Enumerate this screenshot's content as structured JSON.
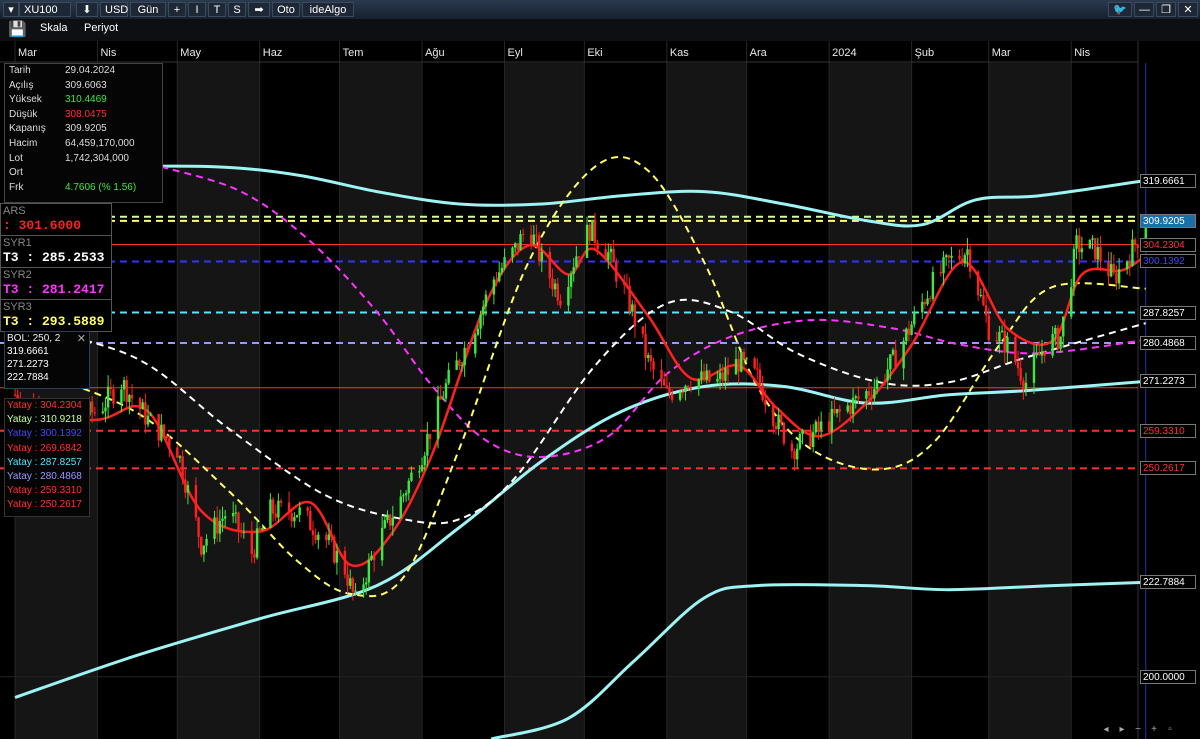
{
  "toolbar": {
    "symbol": "XU100",
    "download": "⬇",
    "currency": "USD",
    "period": "Gün",
    "add": "+",
    "b1": "I",
    "b2": "T",
    "b3": "S",
    "arrow": "➡",
    "auto": "Oto",
    "brand": "ideAlgo"
  },
  "menu": {
    "scale": "Skala",
    "period": "Periyot"
  },
  "info": {
    "rows": [
      {
        "label": "Tarih",
        "value": "29.04.2024",
        "color": "#dddddd"
      },
      {
        "label": "Açılış",
        "value": "309.6063",
        "color": "#dddddd"
      },
      {
        "label": "Yüksek",
        "value": "310.4469",
        "color": "#3ee83e"
      },
      {
        "label": "Düşük",
        "value": "308.0475",
        "color": "#ff3030"
      },
      {
        "label": "Kapanış",
        "value": "309.9205",
        "color": "#dddddd"
      },
      {
        "label": "Hacim",
        "value": "64,459,170,000",
        "color": "#dddddd"
      },
      {
        "label": "Lot",
        "value": "1,742,304,000",
        "color": "#dddddd"
      },
      {
        "label": "Ort",
        "value": "",
        "color": "#dddddd"
      },
      {
        "label": "Frk",
        "value": "4.7606 (% 1.56)",
        "color": "#3ee83e"
      }
    ]
  },
  "ars": {
    "title": "ARS",
    "value": ": 301.6000",
    "color": "#ff2020"
  },
  "syr": [
    {
      "title": "SYR1",
      "value": "T3 : 285.2533",
      "color": "#ffffff"
    },
    {
      "title": "SYR2",
      "value": "T3 : 281.2417",
      "color": "#ff33ff"
    },
    {
      "title": "SYR3",
      "value": "T3 : 293.5889",
      "color": "#ffff66"
    }
  ],
  "bol": {
    "title": "BOL: 250, 2",
    "close": "✕",
    "values": [
      "319.6661",
      "271.2273",
      "222.7884"
    ]
  },
  "yatay": [
    {
      "text": "Yatay : 304.2304",
      "color": "#ff3030"
    },
    {
      "text": "Yatay : 310.9218",
      "color": "#ccff99"
    },
    {
      "text": "Yatay : 300.1392",
      "color": "#4444ff"
    },
    {
      "text": "Yatay : 269.6842",
      "color": "#ff3030"
    },
    {
      "text": "Yatay : 287.8257",
      "color": "#55e5ff"
    },
    {
      "text": "Yatay : 280.4868",
      "color": "#9999ff"
    },
    {
      "text": "Yatay : 259.3310",
      "color": "#ff3030"
    },
    {
      "text": "Yatay : 250.2617",
      "color": "#ff3030"
    }
  ],
  "price_labels": [
    {
      "text": "319.6661",
      "value": 319.6661,
      "color": "#ffffff"
    },
    {
      "text": "309.9205",
      "value": 309.9205,
      "color": "#ffffff",
      "bg": "#1a6fa8"
    },
    {
      "text": "304.2304",
      "value": 304.2304,
      "color": "#ff3030"
    },
    {
      "text": "300.1392",
      "value": 300.1392,
      "color": "#4444ff"
    },
    {
      "text": "287.8257",
      "value": 287.8257,
      "color": "#ffffff"
    },
    {
      "text": "280.4868",
      "value": 280.4868,
      "color": "#ffffff"
    },
    {
      "text": "271.2273",
      "value": 271.2273,
      "color": "#ffffff"
    },
    {
      "text": "259.3310",
      "value": 259.331,
      "color": "#ff3030"
    },
    {
      "text": "250.2617",
      "value": 250.2617,
      "color": "#ff3030"
    },
    {
      "text": "222.7884",
      "value": 222.7884,
      "color": "#ffffff"
    },
    {
      "text": "200.0000",
      "value": 200.0,
      "color": "#ffffff"
    }
  ],
  "chart_data": {
    "type": "candlestick",
    "instrument": "XU100",
    "currency": "USD",
    "interval": "Gün",
    "ylim": [
      185.0,
      348.0
    ],
    "x_range": [
      "2023-03-01",
      "2024-05-10"
    ],
    "month_labels": [
      {
        "label": "Mar",
        "date": "2023-03-01"
      },
      {
        "label": "Nis",
        "date": "2023-04-01"
      },
      {
        "label": "May",
        "date": "2023-05-01"
      },
      {
        "label": "Haz",
        "date": "2023-06-01"
      },
      {
        "label": "Tem",
        "date": "2023-07-01"
      },
      {
        "label": "Ağu",
        "date": "2023-08-01"
      },
      {
        "label": "Eyl",
        "date": "2023-09-01"
      },
      {
        "label": "Eki",
        "date": "2023-10-01"
      },
      {
        "label": "Kas",
        "date": "2023-11-01"
      },
      {
        "label": "Ara",
        "date": "2023-12-01"
      },
      {
        "label": "2024",
        "date": "2024-01-01"
      },
      {
        "label": "Şub",
        "date": "2024-02-01"
      },
      {
        "label": "Mar",
        "date": "2024-03-01"
      },
      {
        "label": "Nis",
        "date": "2024-04-01"
      }
    ],
    "last_candle": {
      "date": "2024-04-29",
      "open": 309.6063,
      "high": 310.4469,
      "low": 308.0475,
      "close": 309.9205
    },
    "closes": [
      {
        "date": "2023-03-01",
        "value": 268
      },
      {
        "date": "2023-03-15",
        "value": 262
      },
      {
        "date": "2023-04-01",
        "value": 264
      },
      {
        "date": "2023-04-10",
        "value": 271
      },
      {
        "date": "2023-04-20",
        "value": 262
      },
      {
        "date": "2023-05-01",
        "value": 255
      },
      {
        "date": "2023-05-10",
        "value": 232
      },
      {
        "date": "2023-05-20",
        "value": 240
      },
      {
        "date": "2023-05-29",
        "value": 230
      },
      {
        "date": "2023-06-05",
        "value": 240
      },
      {
        "date": "2023-06-15",
        "value": 240
      },
      {
        "date": "2023-06-25",
        "value": 234
      },
      {
        "date": "2023-07-03",
        "value": 226
      },
      {
        "date": "2023-07-07",
        "value": 218
      },
      {
        "date": "2023-07-15",
        "value": 232
      },
      {
        "date": "2023-07-25",
        "value": 244
      },
      {
        "date": "2023-08-01",
        "value": 254
      },
      {
        "date": "2023-08-10",
        "value": 270
      },
      {
        "date": "2023-08-20",
        "value": 283
      },
      {
        "date": "2023-08-28",
        "value": 296
      },
      {
        "date": "2023-09-05",
        "value": 303
      },
      {
        "date": "2023-09-10",
        "value": 309
      },
      {
        "date": "2023-09-15",
        "value": 300
      },
      {
        "date": "2023-09-22",
        "value": 292
      },
      {
        "date": "2023-09-28",
        "value": 302
      },
      {
        "date": "2023-10-03",
        "value": 308
      },
      {
        "date": "2023-10-10",
        "value": 302
      },
      {
        "date": "2023-10-18",
        "value": 290
      },
      {
        "date": "2023-10-25",
        "value": 276
      },
      {
        "date": "2023-11-01",
        "value": 268
      },
      {
        "date": "2023-11-10",
        "value": 272
      },
      {
        "date": "2023-11-20",
        "value": 271
      },
      {
        "date": "2023-11-28",
        "value": 276
      },
      {
        "date": "2023-12-05",
        "value": 272
      },
      {
        "date": "2023-12-12",
        "value": 262
      },
      {
        "date": "2023-12-18",
        "value": 255
      },
      {
        "date": "2023-12-25",
        "value": 258
      },
      {
        "date": "2024-01-02",
        "value": 262
      },
      {
        "date": "2024-01-10",
        "value": 266
      },
      {
        "date": "2024-01-18",
        "value": 270
      },
      {
        "date": "2024-01-25",
        "value": 276
      },
      {
        "date": "2024-02-01",
        "value": 285
      },
      {
        "date": "2024-02-08",
        "value": 294
      },
      {
        "date": "2024-02-15",
        "value": 300
      },
      {
        "date": "2024-02-22",
        "value": 303
      },
      {
        "date": "2024-03-01",
        "value": 284
      },
      {
        "date": "2024-03-08",
        "value": 280
      },
      {
        "date": "2024-03-15",
        "value": 271
      },
      {
        "date": "2024-03-22",
        "value": 280
      },
      {
        "date": "2024-03-28",
        "value": 282
      },
      {
        "date": "2024-04-03",
        "value": 304
      },
      {
        "date": "2024-04-10",
        "value": 303
      },
      {
        "date": "2024-04-17",
        "value": 296
      },
      {
        "date": "2024-04-24",
        "value": 303
      },
      {
        "date": "2024-04-29",
        "value": 309.9205
      }
    ],
    "horizontal_lines": [
      {
        "value": 310.9218,
        "color": "#ccff99",
        "style": "dashed"
      },
      {
        "value": 309.9205,
        "color": "#ffff66",
        "style": "dashed"
      },
      {
        "value": 304.2304,
        "color": "#ff3030",
        "style": "solid"
      },
      {
        "value": 300.1392,
        "color": "#3333ff",
        "style": "dashed"
      },
      {
        "value": 287.8257,
        "color": "#55e5ff",
        "style": "dashed"
      },
      {
        "value": 280.4868,
        "color": "#9999ff",
        "style": "dashed"
      },
      {
        "value": 269.6842,
        "color": "#ff3030",
        "style": "solid"
      },
      {
        "value": 259.331,
        "color": "#ff3030",
        "style": "dashed"
      },
      {
        "value": 250.2617,
        "color": "#ff3030",
        "style": "dashed"
      }
    ],
    "overlays": [
      {
        "name": "BOL upper",
        "color": "#9ef3f3",
        "style": "solid",
        "points": [
          {
            "date": "2023-04-01",
            "value": 323
          },
          {
            "date": "2023-05-15",
            "value": 323
          },
          {
            "date": "2023-06-15",
            "value": 321
          },
          {
            "date": "2023-07-15",
            "value": 317
          },
          {
            "date": "2023-08-15",
            "value": 314
          },
          {
            "date": "2023-09-15",
            "value": 314
          },
          {
            "date": "2023-10-15",
            "value": 316
          },
          {
            "date": "2023-11-15",
            "value": 317
          },
          {
            "date": "2023-12-15",
            "value": 314
          },
          {
            "date": "2024-01-15",
            "value": 310
          },
          {
            "date": "2024-02-05",
            "value": 309
          },
          {
            "date": "2024-02-25",
            "value": 315
          },
          {
            "date": "2024-03-20",
            "value": 316
          },
          {
            "date": "2024-04-29",
            "value": 319.6661
          }
        ]
      },
      {
        "name": "BOL middle",
        "color": "#9ef3f3",
        "style": "solid",
        "points": [
          {
            "date": "2023-03-01",
            "value": 195
          },
          {
            "date": "2023-04-15",
            "value": 205
          },
          {
            "date": "2023-06-01",
            "value": 214
          },
          {
            "date": "2023-07-15",
            "value": 222
          },
          {
            "date": "2023-08-15",
            "value": 236
          },
          {
            "date": "2023-09-15",
            "value": 252
          },
          {
            "date": "2023-10-15",
            "value": 264
          },
          {
            "date": "2023-11-15",
            "value": 270
          },
          {
            "date": "2023-12-15",
            "value": 270
          },
          {
            "date": "2024-01-15",
            "value": 266
          },
          {
            "date": "2024-02-15",
            "value": 268
          },
          {
            "date": "2024-03-15",
            "value": 269
          },
          {
            "date": "2024-04-29",
            "value": 271.2273
          }
        ]
      },
      {
        "name": "BOL lower",
        "color": "#9ef3f3",
        "style": "solid",
        "points": [
          {
            "date": "2023-08-27",
            "value": 185
          },
          {
            "date": "2023-09-25",
            "value": 190
          },
          {
            "date": "2023-10-20",
            "value": 204
          },
          {
            "date": "2023-11-15",
            "value": 219
          },
          {
            "date": "2023-12-05",
            "value": 222
          },
          {
            "date": "2024-01-15",
            "value": 222
          },
          {
            "date": "2024-02-15",
            "value": 221
          },
          {
            "date": "2024-03-25",
            "value": 222
          },
          {
            "date": "2024-04-29",
            "value": 222.7884
          }
        ]
      },
      {
        "name": "SYR1",
        "color": "#ffffff",
        "style": "dashed",
        "points": [
          {
            "date": "2023-03-01",
            "value": 285
          },
          {
            "date": "2023-04-15",
            "value": 277
          },
          {
            "date": "2023-05-20",
            "value": 260
          },
          {
            "date": "2023-06-25",
            "value": 244
          },
          {
            "date": "2023-07-25",
            "value": 238
          },
          {
            "date": "2023-08-15",
            "value": 238
          },
          {
            "date": "2023-09-05",
            "value": 248
          },
          {
            "date": "2023-10-05",
            "value": 275
          },
          {
            "date": "2023-11-01",
            "value": 290
          },
          {
            "date": "2023-11-25",
            "value": 288
          },
          {
            "date": "2023-12-20",
            "value": 278
          },
          {
            "date": "2024-01-20",
            "value": 271
          },
          {
            "date": "2024-02-15",
            "value": 271
          },
          {
            "date": "2024-03-15",
            "value": 277
          },
          {
            "date": "2024-04-29",
            "value": 285.2533
          }
        ]
      },
      {
        "name": "SYR2",
        "color": "#ff33ff",
        "style": "dashed",
        "points": [
          {
            "date": "2023-04-25",
            "value": 323
          },
          {
            "date": "2023-05-25",
            "value": 317
          },
          {
            "date": "2023-06-20",
            "value": 305
          },
          {
            "date": "2023-07-15",
            "value": 288
          },
          {
            "date": "2023-08-05",
            "value": 270
          },
          {
            "date": "2023-08-25",
            "value": 257
          },
          {
            "date": "2023-09-15",
            "value": 253
          },
          {
            "date": "2023-10-10",
            "value": 258
          },
          {
            "date": "2023-11-01",
            "value": 273
          },
          {
            "date": "2023-11-25",
            "value": 282
          },
          {
            "date": "2023-12-25",
            "value": 286
          },
          {
            "date": "2024-01-25",
            "value": 284
          },
          {
            "date": "2024-02-20",
            "value": 280
          },
          {
            "date": "2024-03-20",
            "value": 278
          },
          {
            "date": "2024-04-29",
            "value": 281.2417
          }
        ]
      },
      {
        "name": "SYR3",
        "color": "#ffff66",
        "style": "dashed",
        "points": [
          {
            "date": "2023-03-01",
            "value": 275
          },
          {
            "date": "2023-04-15",
            "value": 264
          },
          {
            "date": "2023-05-20",
            "value": 245
          },
          {
            "date": "2023-06-15",
            "value": 228
          },
          {
            "date": "2023-07-05",
            "value": 220
          },
          {
            "date": "2023-07-25",
            "value": 224
          },
          {
            "date": "2023-08-15",
            "value": 255
          },
          {
            "date": "2023-09-10",
            "value": 300
          },
          {
            "date": "2023-10-05",
            "value": 323
          },
          {
            "date": "2023-10-25",
            "value": 322
          },
          {
            "date": "2023-11-15",
            "value": 300
          },
          {
            "date": "2023-12-05",
            "value": 270
          },
          {
            "date": "2023-12-25",
            "value": 255
          },
          {
            "date": "2024-01-20",
            "value": 250
          },
          {
            "date": "2024-02-10",
            "value": 257
          },
          {
            "date": "2024-03-05",
            "value": 280
          },
          {
            "date": "2024-03-25",
            "value": 294
          },
          {
            "date": "2024-04-29",
            "value": 293.5889
          }
        ]
      },
      {
        "name": "ARS",
        "color": "#ff2020",
        "style": "solid",
        "points": [
          {
            "date": "2023-03-01",
            "value": 262
          },
          {
            "date": "2023-04-01",
            "value": 262
          },
          {
            "date": "2023-04-20",
            "value": 264
          },
          {
            "date": "2023-05-10",
            "value": 240
          },
          {
            "date": "2023-06-01",
            "value": 235
          },
          {
            "date": "2023-06-20",
            "value": 242
          },
          {
            "date": "2023-07-05",
            "value": 227
          },
          {
            "date": "2023-07-20",
            "value": 234
          },
          {
            "date": "2023-08-05",
            "value": 254
          },
          {
            "date": "2023-08-25",
            "value": 290
          },
          {
            "date": "2023-09-10",
            "value": 304
          },
          {
            "date": "2023-09-25",
            "value": 297
          },
          {
            "date": "2023-10-05",
            "value": 303
          },
          {
            "date": "2023-10-25",
            "value": 287
          },
          {
            "date": "2023-11-10",
            "value": 272
          },
          {
            "date": "2023-11-28",
            "value": 275
          },
          {
            "date": "2023-12-12",
            "value": 265
          },
          {
            "date": "2023-12-28",
            "value": 258
          },
          {
            "date": "2024-01-15",
            "value": 266
          },
          {
            "date": "2024-02-01",
            "value": 280
          },
          {
            "date": "2024-02-20",
            "value": 300
          },
          {
            "date": "2024-03-08",
            "value": 284
          },
          {
            "date": "2024-03-25",
            "value": 281
          },
          {
            "date": "2024-04-05",
            "value": 297
          },
          {
            "date": "2024-04-20",
            "value": 298
          },
          {
            "date": "2024-04-29",
            "value": 301.6
          }
        ]
      }
    ],
    "series_labels": [
      "ARS",
      "SYR1",
      "SYR2",
      "SYR3",
      "BOL: 250, 2"
    ]
  }
}
